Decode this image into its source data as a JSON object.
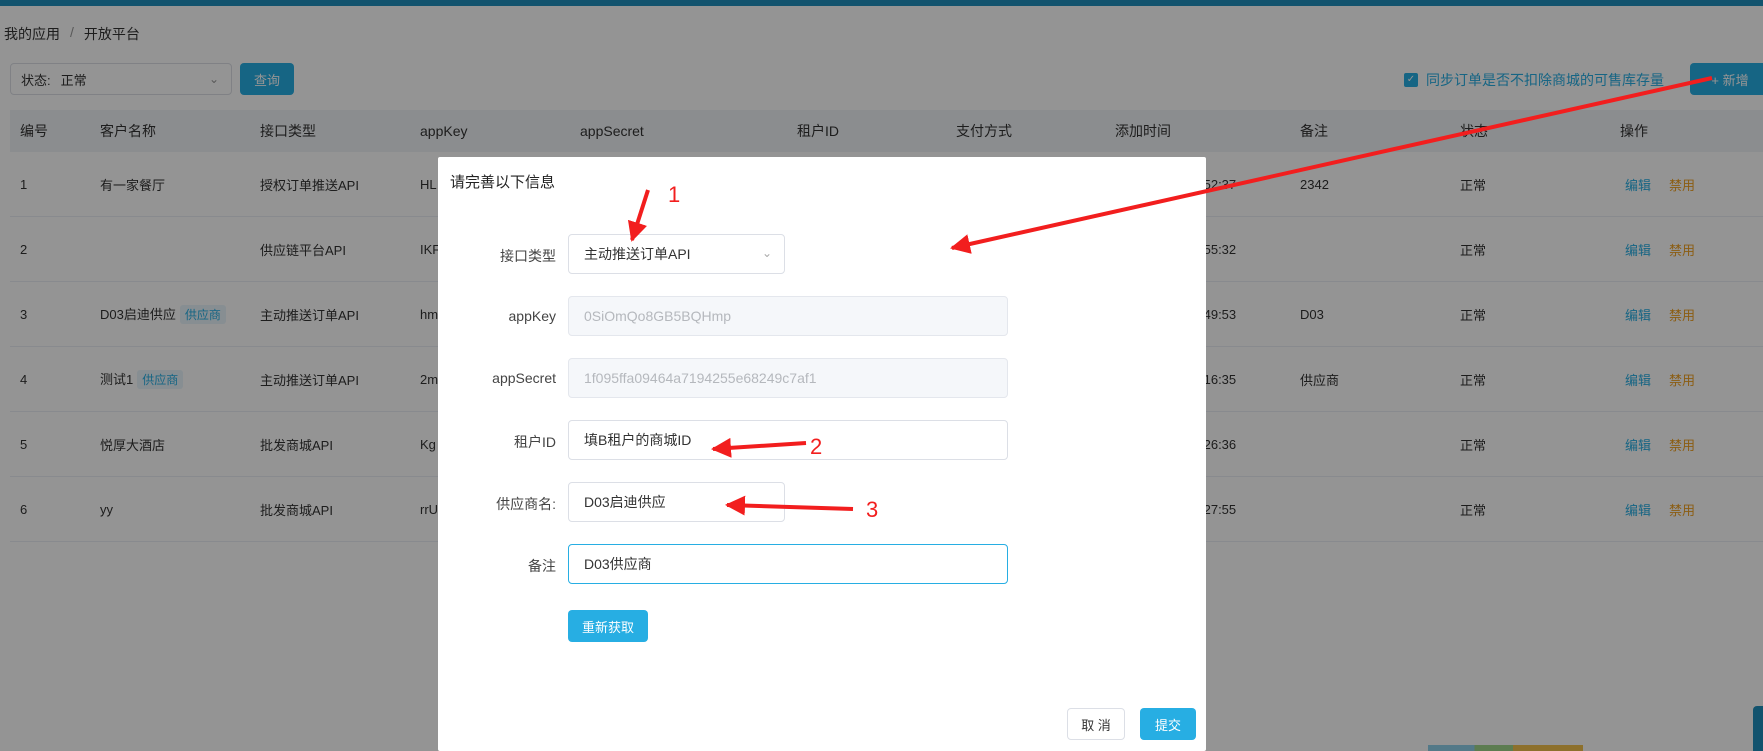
{
  "breadcrumb": [
    "我的应用",
    "开放平台"
  ],
  "filter": {
    "status_label": "状态:",
    "status_value": "正常",
    "query_button": "查询"
  },
  "sync_option": {
    "label": "同步订单是否不扣除商城的可售库存量",
    "checked": true
  },
  "add_button": "+ 新增",
  "table": {
    "headers": [
      "编号",
      "客户名称",
      "接口类型",
      "appKey",
      "appSecret",
      "租户ID",
      "支付方式",
      "添加时间",
      "备注",
      "状态",
      "操作"
    ],
    "rows": [
      {
        "id": "1",
        "name": "有一家餐厅",
        "tag": "",
        "type": "授权订单推送API",
        "appkey": "HL",
        "time": ":52:37",
        "note": "2342",
        "status": "正常",
        "edit": "编辑",
        "ban": "禁用"
      },
      {
        "id": "2",
        "name": "",
        "tag": "",
        "type": "供应链平台API",
        "appkey": "IKF",
        "time": ":55:32",
        "note": "",
        "status": "正常",
        "edit": "编辑",
        "ban": "禁用"
      },
      {
        "id": "3",
        "name": "D03启迪供应",
        "tag": "供应商",
        "type": "主动推送订单API",
        "appkey": "hm",
        "time": ":49:53",
        "note": "D03",
        "status": "正常",
        "edit": "编辑",
        "ban": "禁用"
      },
      {
        "id": "4",
        "name": "测试1",
        "tag": "供应商",
        "type": "主动推送订单API",
        "appkey": "2m",
        "time": ":16:35",
        "note": "供应商",
        "status": "正常",
        "edit": "编辑",
        "ban": "禁用"
      },
      {
        "id": "5",
        "name": "悦厚大酒店",
        "tag": "",
        "type": "批发商城API",
        "appkey": "Kg",
        "time": ":26:36",
        "note": "",
        "status": "正常",
        "edit": "编辑",
        "ban": "禁用"
      },
      {
        "id": "6",
        "name": "yy",
        "tag": "",
        "type": "批发商城API",
        "appkey": "rrU",
        "time": ":27:55",
        "note": "",
        "status": "正常",
        "edit": "编辑",
        "ban": "禁用"
      }
    ]
  },
  "modal": {
    "title": "请完善以下信息",
    "fields": {
      "type_label": "接口类型",
      "type_value": "主动推送订单API",
      "appkey_label": "appKey",
      "appkey_value": "0SiOmQo8GB5BQHmp",
      "appsecret_label": "appSecret",
      "appsecret_value": "1f095ffa09464a7194255e68249c7af1",
      "tenant_label": "租户ID",
      "tenant_value": "填B租户的商城ID",
      "supplier_label": "供应商名:",
      "supplier_value": "D03启迪供应",
      "note_label": "备注",
      "note_value": "D03供应商"
    },
    "refresh_button": "重新获取",
    "cancel_button": "取 消",
    "submit_button": "提交"
  },
  "annotations": [
    "1",
    "2",
    "3"
  ],
  "colors": {
    "accent": "#27aee3",
    "warning": "#f0a020",
    "annotation_red": "#f21e1e"
  }
}
